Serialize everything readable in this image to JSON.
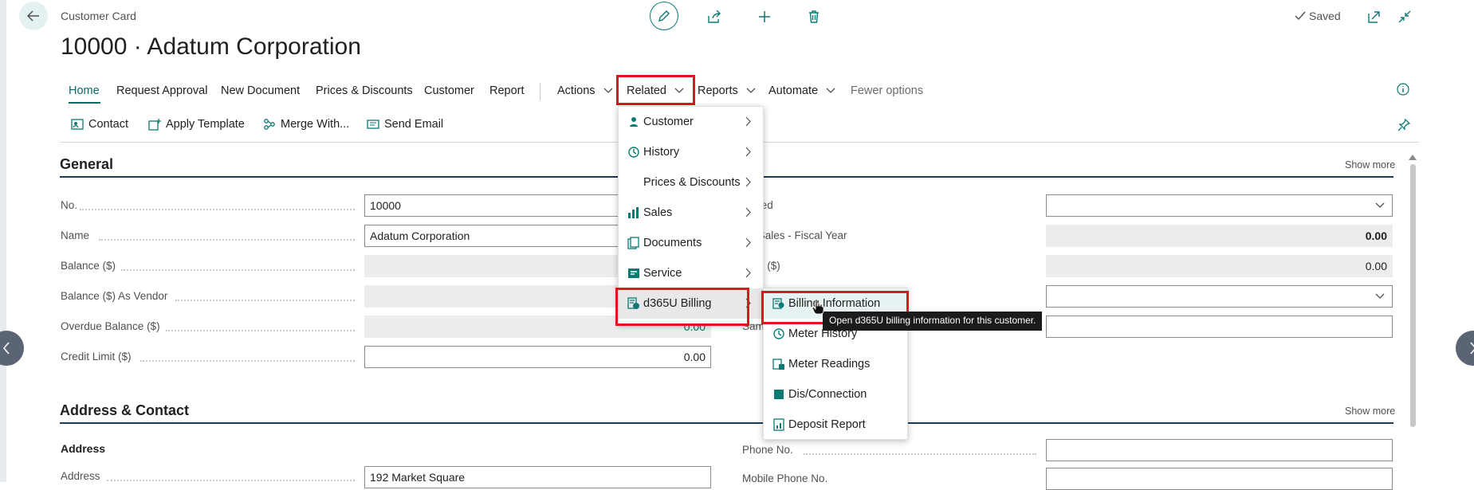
{
  "header": {
    "breadcrumb": "Customer Card",
    "title": "10000 · Adatum Corporation",
    "saved_label": "Saved"
  },
  "tabs": [
    {
      "label": "Home"
    },
    {
      "label": "Request Approval"
    },
    {
      "label": "New Document"
    },
    {
      "label": "Prices & Discounts"
    },
    {
      "label": "Customer"
    },
    {
      "label": "Report"
    },
    {
      "label": "Actions"
    },
    {
      "label": "Related"
    },
    {
      "label": "Reports"
    },
    {
      "label": "Automate"
    },
    {
      "label": "Fewer options"
    }
  ],
  "subbar": [
    {
      "label": "Contact"
    },
    {
      "label": "Apply Template"
    },
    {
      "label": "Merge With..."
    },
    {
      "label": "Send Email"
    }
  ],
  "general": {
    "title": "General",
    "show_more": "Show more",
    "left_fields": [
      {
        "label": "No.",
        "value": "10000"
      },
      {
        "label": "Name",
        "value": "Adatum Corporation"
      },
      {
        "label": "Balance ($)",
        "value": ""
      },
      {
        "label": "Balance ($) As Vendor",
        "value": ""
      },
      {
        "label": "Overdue Balance ($)",
        "value": "0.00"
      },
      {
        "label": "Credit Limit ($)",
        "value": "0.00"
      }
    ],
    "right_fields": [
      {
        "label": "ked",
        "value": ""
      },
      {
        "label": "l Sales - Fiscal Year",
        "value": "0.00"
      },
      {
        "label": "ts ($)",
        "value": "0.00"
      },
      {
        "label": "",
        "value": ""
      },
      {
        "label": "Sam",
        "value": ""
      }
    ]
  },
  "address": {
    "title": "Address & Contact",
    "show_more": "Show more",
    "subheading": "Address",
    "address_label": "Address",
    "address_value": "192 Market Square",
    "phone_label": "Phone No.",
    "mobile_label": "Mobile Phone No."
  },
  "related_menu": [
    {
      "label": "Customer",
      "icon": "person-icon"
    },
    {
      "label": "History",
      "icon": "history-icon"
    },
    {
      "label": "Prices & Discounts",
      "icon": ""
    },
    {
      "label": "Sales",
      "icon": "sales-icon"
    },
    {
      "label": "Documents",
      "icon": "documents-icon"
    },
    {
      "label": "Service",
      "icon": "service-icon"
    },
    {
      "label": "d365U Billing",
      "icon": "billing-icon"
    }
  ],
  "billing_menu": [
    {
      "label": "Billing Information",
      "icon": "billing-info-icon"
    },
    {
      "label": "Meter History",
      "icon": "history-icon"
    },
    {
      "label": "Meter Readings",
      "icon": "meter-readings-icon"
    },
    {
      "label": "Dis/Connection",
      "icon": "square-icon"
    },
    {
      "label": "Deposit Report",
      "icon": "report-icon"
    }
  ],
  "tooltip": "Open d365U billing information for this customer.",
  "colors": {
    "accent": "#0b6a66",
    "highlight_box": "#e0141c"
  }
}
